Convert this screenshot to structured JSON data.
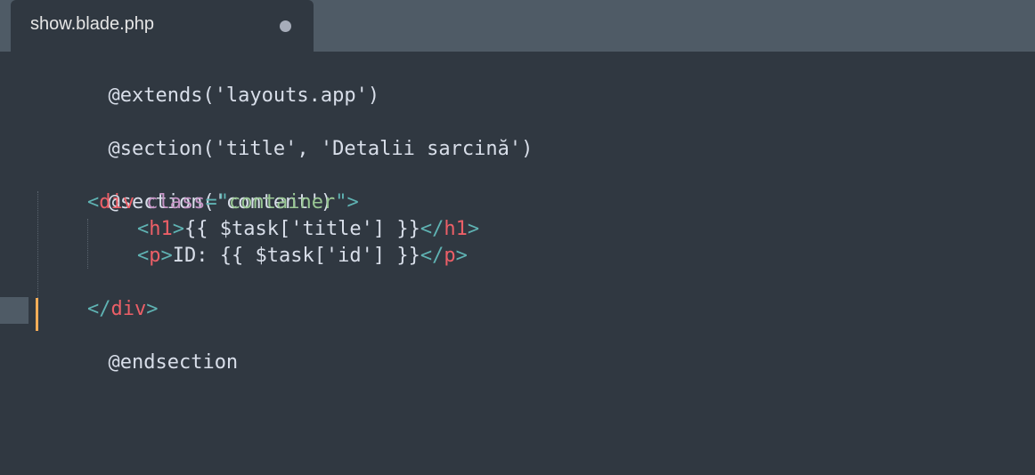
{
  "tab": {
    "title": "show.blade.php",
    "modified_indicator": "unsaved-dot"
  },
  "colors": {
    "background": "#303841",
    "tab_bar": "#4f5b66",
    "default_text": "#d8dee9",
    "punctuation": "#5fb3b3",
    "tag": "#ec5f67",
    "attribute": "#c594c5",
    "string": "#99c794",
    "caret": "#f9ae58"
  },
  "code": {
    "line1": "@extends('layouts.app')",
    "line3": "@section('title', 'Detalii sarcină')",
    "line5": "@section('content')",
    "line6": {
      "open": "<",
      "tag": "div",
      "attr": " class",
      "eq": "=",
      "q1": "\"",
      "value": "container",
      "q2": "\"",
      "close": ">"
    },
    "line7": {
      "open": "<",
      "tag": "h1",
      "close": ">",
      "content": "{{ $task['title'] }}",
      "end_open": "</",
      "end_tag": "h1",
      "end_close": ">"
    },
    "line8": {
      "open": "<",
      "tag": "p",
      "close": ">",
      "content": "ID: {{ $task['id'] }}",
      "end_open": "</",
      "end_tag": "p",
      "end_close": ">"
    },
    "line10": {
      "open": "</",
      "tag": "div",
      "close": ">"
    },
    "line11": "@endsection"
  }
}
